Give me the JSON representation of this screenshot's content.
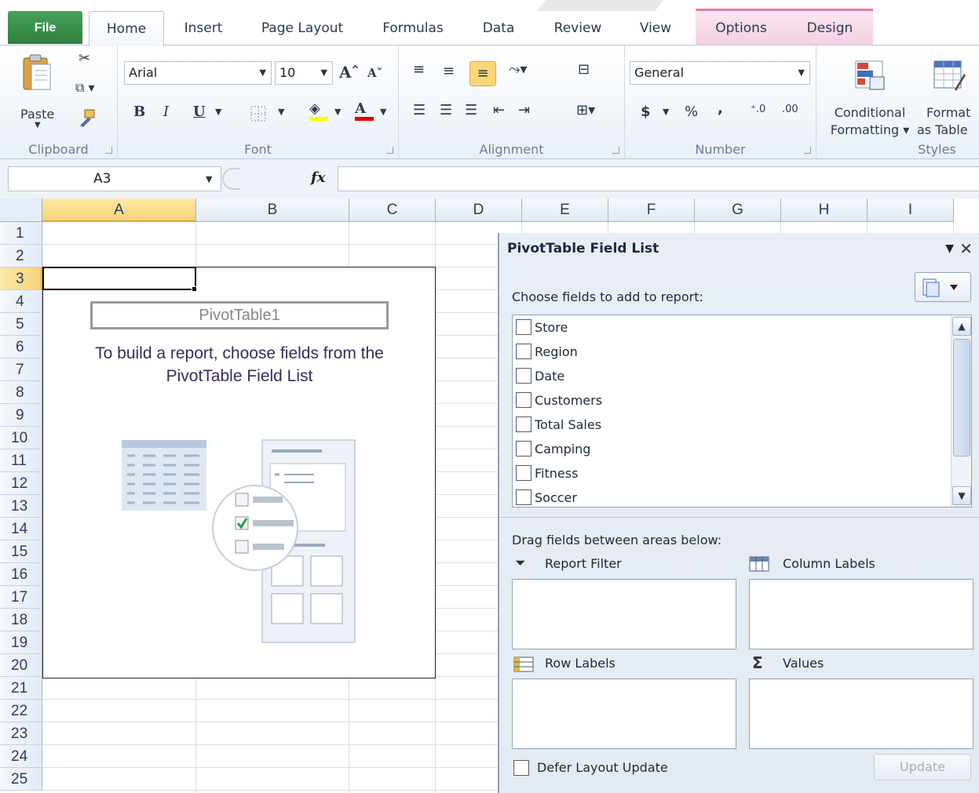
{
  "ribbon_tabs": [
    {
      "label": "File"
    },
    {
      "label": "Home"
    },
    {
      "label": "Insert"
    },
    {
      "label": "Page Layout"
    },
    {
      "label": "Formulas"
    },
    {
      "label": "Data"
    },
    {
      "label": "Review"
    },
    {
      "label": "View"
    },
    {
      "label": "Options"
    },
    {
      "label": "Design"
    }
  ],
  "active_tab": "Home",
  "ribbon": {
    "clipboard": {
      "paste_label": "Paste",
      "group_label": "Clipboard"
    },
    "font": {
      "font_name": "Arial",
      "font_size": "10",
      "bold": "B",
      "italic": "I",
      "underline": "U",
      "group_label": "Font"
    },
    "alignment": {
      "group_label": "Alignment"
    },
    "number": {
      "format": "General",
      "currency": "$",
      "percent": "%",
      "comma": ",",
      "group_label": "Number"
    },
    "styles": {
      "conditional_line1": "Conditional",
      "conditional_line2": "Formatting ▾",
      "format_table_line1": "Format",
      "format_table_line2": "as Table",
      "group_label": "Styles"
    }
  },
  "formula_bar": {
    "name_box": "A3",
    "fx": "fx",
    "formula": ""
  },
  "grid": {
    "columns": [
      "A",
      "B",
      "C",
      "D",
      "E",
      "F",
      "G",
      "H",
      "I"
    ],
    "rows": [
      "1",
      "2",
      "3",
      "4",
      "5",
      "6",
      "7",
      "8",
      "9",
      "10",
      "11",
      "12",
      "13",
      "14",
      "15",
      "16",
      "17",
      "18",
      "19",
      "20",
      "21",
      "22",
      "23",
      "24",
      "25"
    ],
    "selected_column": "A",
    "selected_row": "3"
  },
  "pivot_placeholder": {
    "name": "PivotTable1",
    "hint_line1": "To build a report, choose fields from the",
    "hint_line2": "PivotTable Field List"
  },
  "field_list": {
    "title": "PivotTable Field List",
    "choose_label": "Choose fields to add to report:",
    "fields": [
      {
        "label": "Store",
        "checked": false
      },
      {
        "label": "Region",
        "checked": false
      },
      {
        "label": "Date",
        "checked": false
      },
      {
        "label": "Customers",
        "checked": false
      },
      {
        "label": "Total Sales",
        "checked": false
      },
      {
        "label": "Camping",
        "checked": false
      },
      {
        "label": "Fitness",
        "checked": false
      },
      {
        "label": "Soccer",
        "checked": false
      }
    ],
    "drag_label": "Drag fields between areas below:",
    "areas": {
      "report_filter": "Report Filter",
      "column_labels": "Column Labels",
      "row_labels": "Row Labels",
      "values": "Values"
    },
    "defer_label": "Defer Layout Update",
    "update_label": "Update"
  }
}
